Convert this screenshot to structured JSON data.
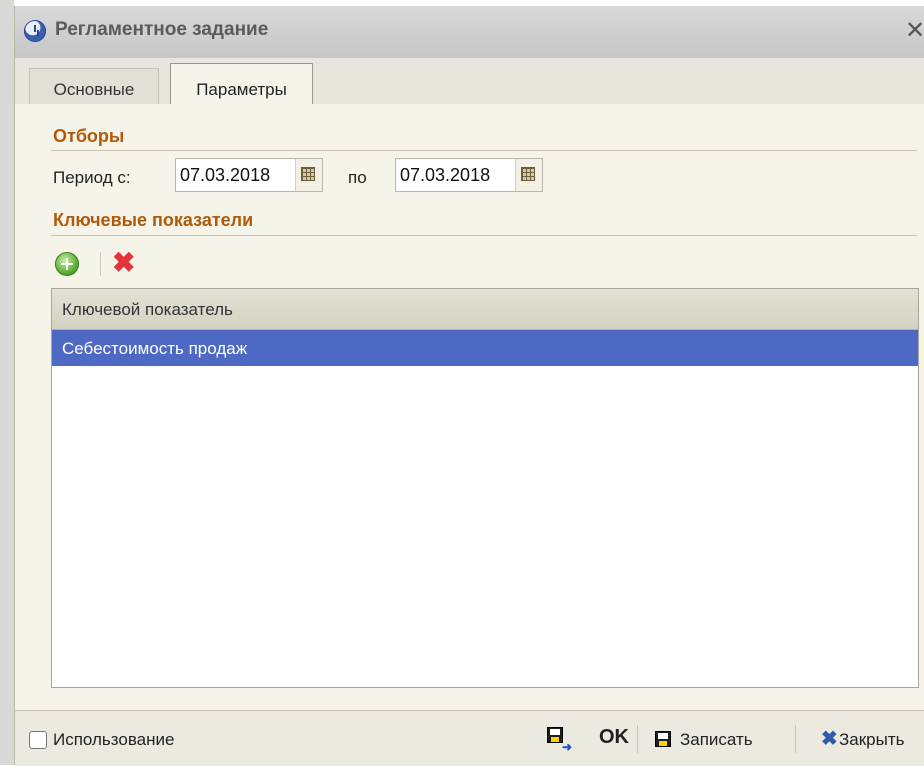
{
  "window": {
    "title": "Регламентное задание",
    "close_glyph": "✕"
  },
  "tabs": [
    {
      "label": "Основные",
      "active": false
    },
    {
      "label": "Параметры",
      "active": true
    }
  ],
  "filters": {
    "group_title": "Отборы",
    "period_from_label": "Период с:",
    "period_from_value": "07.03.2018",
    "period_to_label": "по",
    "period_to_value": "07.03.2018"
  },
  "indicators": {
    "group_title": "Ключевые показатели",
    "add_icon": "add-icon",
    "delete_icon": "delete-icon",
    "column_header": "Ключевой показатель",
    "rows": [
      "Себестоимость продаж"
    ],
    "selected_row_color": "#4e69c4"
  },
  "footer": {
    "usage_label": "Использование",
    "usage_checked": false,
    "ok_label": "OK",
    "save_label": "Записать",
    "close_label": "Закрыть",
    "close_glyph": "✖"
  },
  "colors": {
    "group_title": "#b05a0c",
    "background": "#f6f4e8"
  }
}
